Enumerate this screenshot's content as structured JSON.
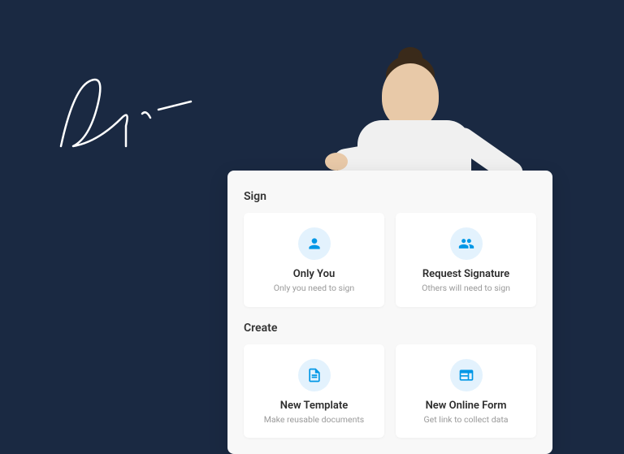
{
  "sections": {
    "sign": {
      "header": "Sign",
      "cards": [
        {
          "title": "Only You",
          "subtitle": "Only you need to sign",
          "icon": "person-icon"
        },
        {
          "title": "Request Signature",
          "subtitle": "Others will need to sign",
          "icon": "people-icon"
        }
      ]
    },
    "create": {
      "header": "Create",
      "cards": [
        {
          "title": "New Template",
          "subtitle": "Make reusable documents",
          "icon": "document-icon"
        },
        {
          "title": "New Online Form",
          "subtitle": "Get link to collect data",
          "icon": "form-icon"
        }
      ]
    }
  }
}
